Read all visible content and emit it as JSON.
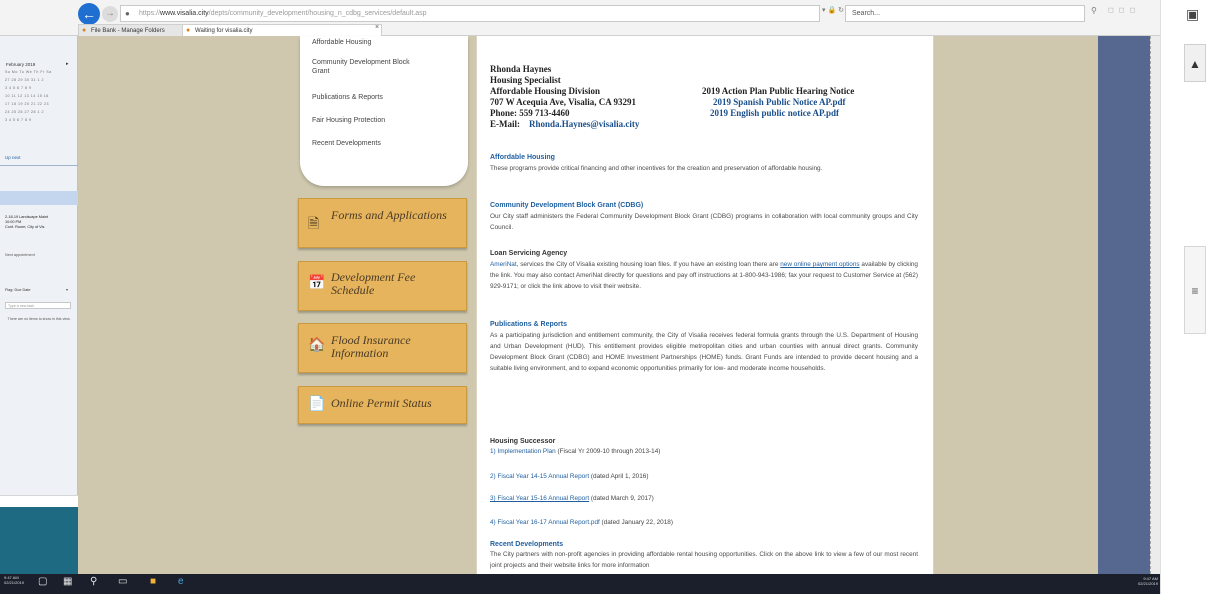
{
  "browser": {
    "url_prefix": "https://",
    "url_domain": "www.visalia.city",
    "url_path": "/depts/community_development/housing_n_cdbg_services/default.asp",
    "addr_icons": "▾ 🔒 ↻",
    "search_placeholder": "Search...",
    "tabs": [
      {
        "label": "File Bank - Manage Folders"
      },
      {
        "label": "Waiting for visalia.city"
      }
    ],
    "tab_close": "×"
  },
  "outlook": {
    "calendar_title": "February 2019",
    "calendar_rows": [
      "Su Mo Tu We Th Fr Sa",
      "27 28 29 30 31  1  2",
      " 3  4  5  6  7  8  9",
      "10 11 12 13 14 15 16",
      "17 18 19 20 21 22 23",
      "24 25 26 27 28  1  2",
      " 3  4  5  6  7  8  9"
    ],
    "next_label": "Up next",
    "appointments": [
      "2-18-19 Landscape Maint",
      "10:00 PM",
      "Conf. Room; City of Vis"
    ],
    "more_appointments": "Next appointment",
    "flag_label": "Flag: Due Date",
    "task_placeholder": "Type a new task",
    "todo_text": "There are no items to show in this view."
  },
  "sidebar": {
    "menu_items": [
      "Affordable Housing",
      "Community Development Block Grant",
      "Publications & Reports",
      "Fair Housing Protection",
      "Recent Developments"
    ],
    "buttons": [
      {
        "label": "Forms and Applications",
        "icon": "document-icon"
      },
      {
        "label": "Development Fee Schedule",
        "icon": "calendar-icon"
      },
      {
        "label": "Flood Insurance Information",
        "icon": "house-icon"
      },
      {
        "label": "Online Permit Status",
        "icon": "file-icon"
      }
    ]
  },
  "contact": {
    "name": "Rhonda Haynes",
    "title": "Housing Specialist",
    "division": "Affordable Housing Division",
    "address": "707 W Acequia Ave, Visalia, CA 93291",
    "phone": "Phone:  559 713-4460",
    "email_label": "E-Mail:",
    "email": "Rhonda.Haynes@visalia.city"
  },
  "notice": {
    "title": "2019 Action Plan Public Hearing Notice",
    "links": [
      "2019 Spanish Public Notice AP.pdf",
      "2019 English public notice AP.pdf"
    ]
  },
  "sections": {
    "affordable": {
      "heading": "Affordable Housing",
      "text": "These programs provide critical financing and other incentives for the creation and preservation of affordable housing."
    },
    "cdbg": {
      "heading": "Community Development Block Grant (CDBG)",
      "text": "Our City staff administers the Federal Community Development Block Grant (CDBG) programs in collaboration with local community groups and City Council."
    },
    "loan": {
      "heading": "Loan Servicing Agency",
      "link1": "AmeriNat",
      "text1": ", services the City of Visalia existing housing loan files. If you have an existing loan there are ",
      "link2": "new online payment options",
      "text2": " available by clicking the link.  You may also contact AmeriNat directly for questions and pay off instructions at 1-800-943-1986; fax your request to Customer Service at (562) 929-9171; or click the link above to visit their website."
    },
    "publications": {
      "heading": "Publications & Reports",
      "text": "As a participating jurisdiction and entitlement community, the City of Visalia receives federal formula grants through the U.S. Department of Housing and Urban Development (HUD).  This entitlement provides eligible metropolitan cities and urban counties with annual direct grants.  Community Development Block Grant (CDBG) and HOME Investment Partnerships (HOME) funds.  Grant Funds are intended to provide decent housing and a suitable living environment, and to expand economic opportunities primarily for low- and moderate income households."
    },
    "successor": {
      "heading": "Housing Successor",
      "items": [
        {
          "link": "1) Implementation Plan",
          "note": " (Fiscal Yr 2009-10 through 2013-14)"
        },
        {
          "link": "2) Fiscal Year 14-15 Annual Report",
          "note": " (dated April 1, 2016)"
        },
        {
          "link": "3) Fiscal Year 15-16 Annual Report",
          "note": " (dated March 9, 2017)"
        },
        {
          "link": "4) Fiscal Year 16-17 Annual Report.pdf",
          "note": " (dated January 22, 2018)"
        }
      ]
    },
    "recent": {
      "heading": "Recent Developments",
      "text": "The City partners with non-profit agencies in providing affordable rental housing opportunities. Click on the above link to view a few of our most recent joint projects and their website links for more information"
    }
  },
  "taskbar": {
    "time": "9:47 AM",
    "date": "02/21/2019"
  },
  "colors": {
    "page_bg": "#cfc8ae",
    "button_gold": "#e5b45c",
    "link_blue": "#1a4f8b",
    "right_strip": "#56688f"
  }
}
